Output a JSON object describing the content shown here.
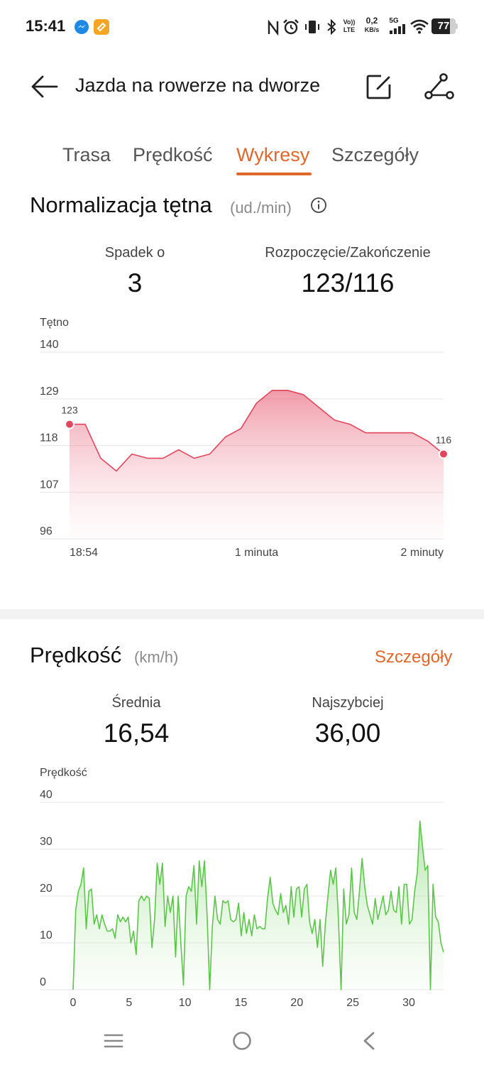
{
  "status_bar": {
    "time": "15:41",
    "volte": "Vo)) LTE",
    "net_speed": "0,2",
    "net_unit": "KB/s",
    "network": "5G",
    "battery": "77"
  },
  "header": {
    "title": "Jazda na rowerze na dworze",
    "icons": [
      "back-arrow-icon",
      "edit-icon",
      "share-route-icon"
    ]
  },
  "tabs": [
    {
      "label": "Trasa",
      "active": false
    },
    {
      "label": "Prędkość",
      "active": false
    },
    {
      "label": "Wykresy",
      "active": true
    },
    {
      "label": "Szczegóły",
      "active": false
    }
  ],
  "heart": {
    "title": "Normalizacja tętna",
    "unit": "(ud./min)",
    "stats": [
      {
        "label": "Spadek o",
        "value": "3"
      },
      {
        "label": "Rozpoczęcie/Zakończenie",
        "value": "123/116"
      }
    ],
    "ylabel": "Tętno",
    "start_label": "123",
    "end_label": "116",
    "xticks": [
      "18:54",
      "1 minuta",
      "2 minuty"
    ]
  },
  "speed": {
    "title": "Prędkość",
    "unit": "(km/h)",
    "details_link": "Szczegóły",
    "stats": [
      {
        "label": "Średnia",
        "value": "16,54"
      },
      {
        "label": "Najszybciej",
        "value": "36,00"
      }
    ],
    "ylabel": "Prędkość"
  },
  "chart_data": [
    {
      "type": "area",
      "ylabel": "Tętno",
      "ylim": [
        96,
        140
      ],
      "yticks": [
        140,
        129,
        118,
        107,
        96
      ],
      "xticks": [
        "18:54",
        "1 minuta",
        "2 minuty"
      ],
      "grid": true,
      "color": "#e0475e",
      "x_seconds": [
        0,
        5,
        10,
        15,
        20,
        25,
        30,
        35,
        40,
        45,
        50,
        55,
        60,
        65,
        70,
        75,
        80,
        85,
        90,
        95,
        100,
        105,
        110,
        115,
        120
      ],
      "values": [
        123,
        123,
        115,
        112,
        116,
        115,
        115,
        117,
        115,
        116,
        120,
        122,
        128,
        131,
        131,
        130,
        127,
        124,
        123,
        121,
        121,
        121,
        121,
        119,
        116
      ]
    },
    {
      "type": "area",
      "ylabel": "Prędkość",
      "ylim": [
        0,
        40
      ],
      "yticks": [
        40,
        30,
        20,
        10,
        0
      ],
      "xticks": [
        0,
        5,
        10,
        15,
        20,
        25,
        30
      ],
      "grid": true,
      "color": "#5cc64a",
      "values": [
        0,
        17,
        21,
        22.5,
        26,
        13,
        21,
        21.5,
        14,
        16,
        13,
        16,
        14,
        12.5,
        12.5,
        13,
        11,
        16,
        14.5,
        15.5,
        14.5,
        15.5,
        10,
        12.5,
        7.5,
        19,
        20,
        19,
        20,
        19.5,
        9,
        15,
        27,
        22.5,
        27,
        13.5,
        20,
        16.5,
        20,
        7,
        20,
        10,
        1,
        20,
        22,
        21,
        26.5,
        14,
        27.5,
        22,
        27.5,
        16,
        0,
        13.5,
        20,
        15,
        14,
        19,
        18.5,
        19,
        15,
        14.5,
        15,
        18.5,
        11.5,
        16.5,
        12,
        15,
        11.5,
        16,
        13,
        13.5,
        13,
        13,
        19.5,
        24,
        18.5,
        17,
        16,
        20.5,
        16.5,
        18,
        14,
        22,
        15.5,
        21.5,
        22,
        15.5,
        21.5,
        22.5,
        14.5,
        12,
        15,
        9,
        15,
        5,
        14,
        20,
        25.5,
        22.5,
        26,
        15,
        0,
        21.5,
        14,
        16,
        26,
        16.5,
        15,
        21,
        28,
        22,
        18,
        16,
        14,
        19.5,
        15,
        17.5,
        20,
        16,
        17,
        21,
        17,
        16.5,
        22,
        14,
        22.5,
        22.5,
        14,
        15,
        21,
        25,
        36,
        30.5,
        25.5,
        26.5,
        0,
        22.5,
        15.5,
        14.5,
        10,
        8
      ]
    }
  ]
}
